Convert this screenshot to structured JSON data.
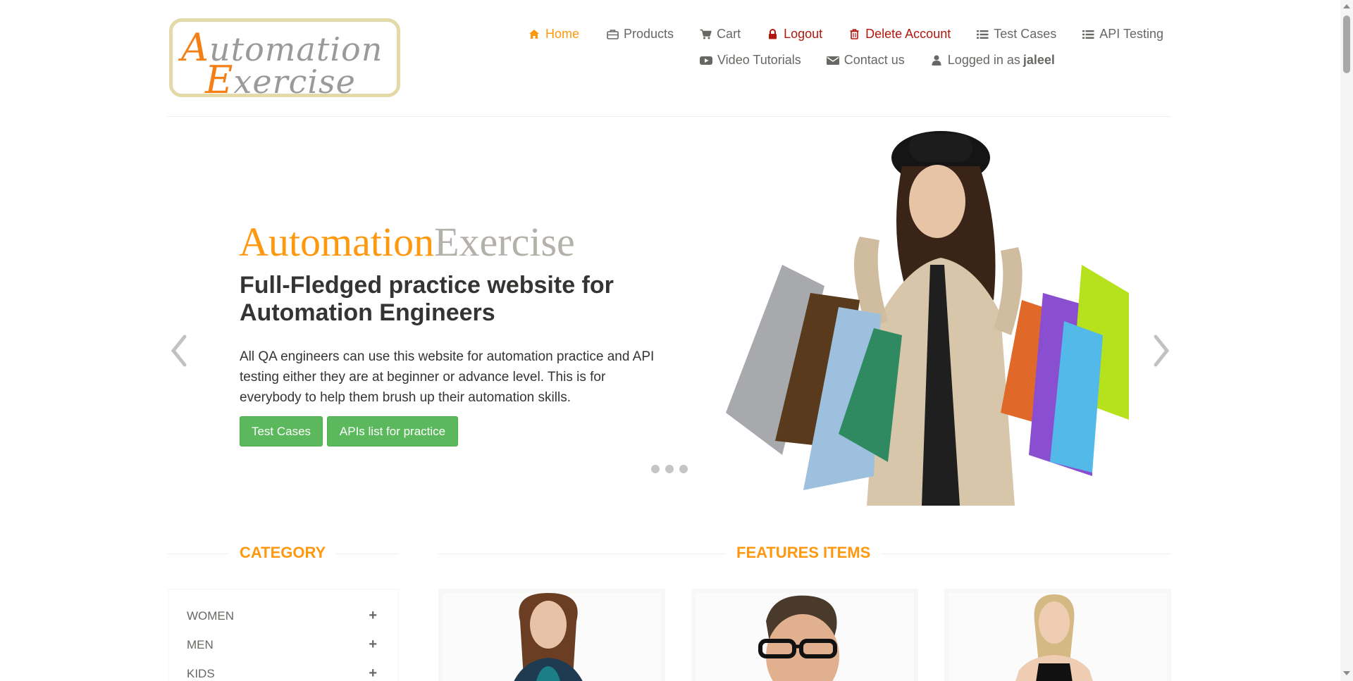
{
  "logo": {
    "line1_cap": "A",
    "line1_rest": "utomation",
    "line2_cap": "E",
    "line2_rest": "xercise"
  },
  "nav": {
    "home": "Home",
    "products": "Products",
    "cart": "Cart",
    "logout": "Logout",
    "delete_account": "Delete Account",
    "test_cases": "Test Cases",
    "api_testing": "API Testing",
    "video_tutorials": "Video Tutorials",
    "contact_us": "Contact us",
    "logged_in_prefix": "Logged in as",
    "username": "jaleel"
  },
  "icons": {
    "home": "home-icon",
    "products": "briefcase-icon",
    "cart": "cart-icon",
    "logout": "lock-icon",
    "delete": "trash-icon",
    "test_cases": "list-icon",
    "api_testing": "list-icon",
    "video": "youtube-icon",
    "contact": "envelope-icon",
    "user": "user-icon"
  },
  "colors": {
    "accent": "#fe980f",
    "danger": "#b2170f",
    "button": "#5cb85c",
    "text": "#696763",
    "heading": "#363432"
  },
  "hero": {
    "brand_a": "Automation",
    "brand_b": "Exercise",
    "heading": "Full-Fledged practice website for Automation Engineers",
    "paragraph": "All QA engineers can use this website for automation practice and API testing either they are at beginner or advance level. This is for everybody to help them brush up their automation skills.",
    "button_test_cases": "Test Cases",
    "button_apis": "APIs list for practice",
    "slide_count": 3
  },
  "sections": {
    "category": "CATEGORY",
    "features": "FEATURES ITEMS"
  },
  "categories": [
    {
      "label": "WOMEN"
    },
    {
      "label": "MEN"
    },
    {
      "label": "KIDS"
    }
  ]
}
